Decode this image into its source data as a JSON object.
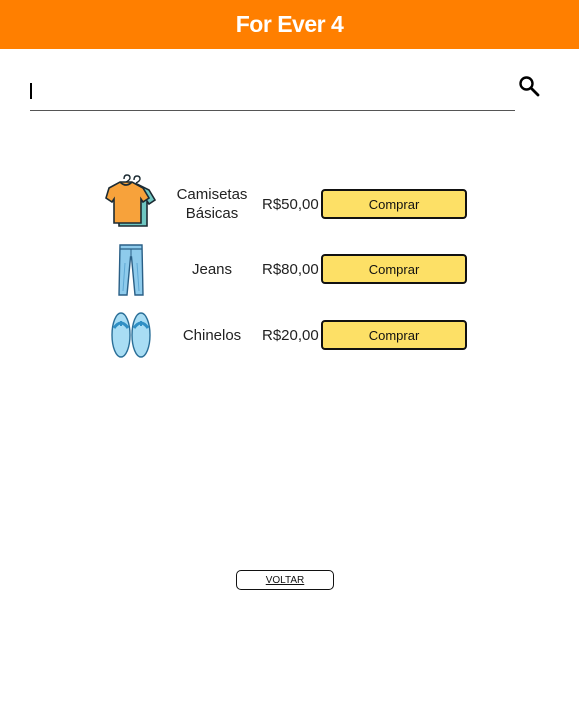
{
  "header": {
    "title": "For Ever 4"
  },
  "search": {
    "value": "",
    "placeholder": "",
    "icon": "search-icon"
  },
  "products": [
    {
      "name": "Camisetas Básicas",
      "price": "R$50,00",
      "button": "Comprar",
      "icon": "tshirt-icon"
    },
    {
      "name": "Jeans",
      "price": "R$80,00",
      "button": "Comprar",
      "icon": "jeans-icon"
    },
    {
      "name": "Chinelos",
      "price": "R$20,00",
      "button": "Comprar",
      "icon": "flip-flops-icon"
    }
  ],
  "back_button": "VOLTAR",
  "colors": {
    "header": "#ff7f00",
    "buy_button": "#fde066"
  }
}
